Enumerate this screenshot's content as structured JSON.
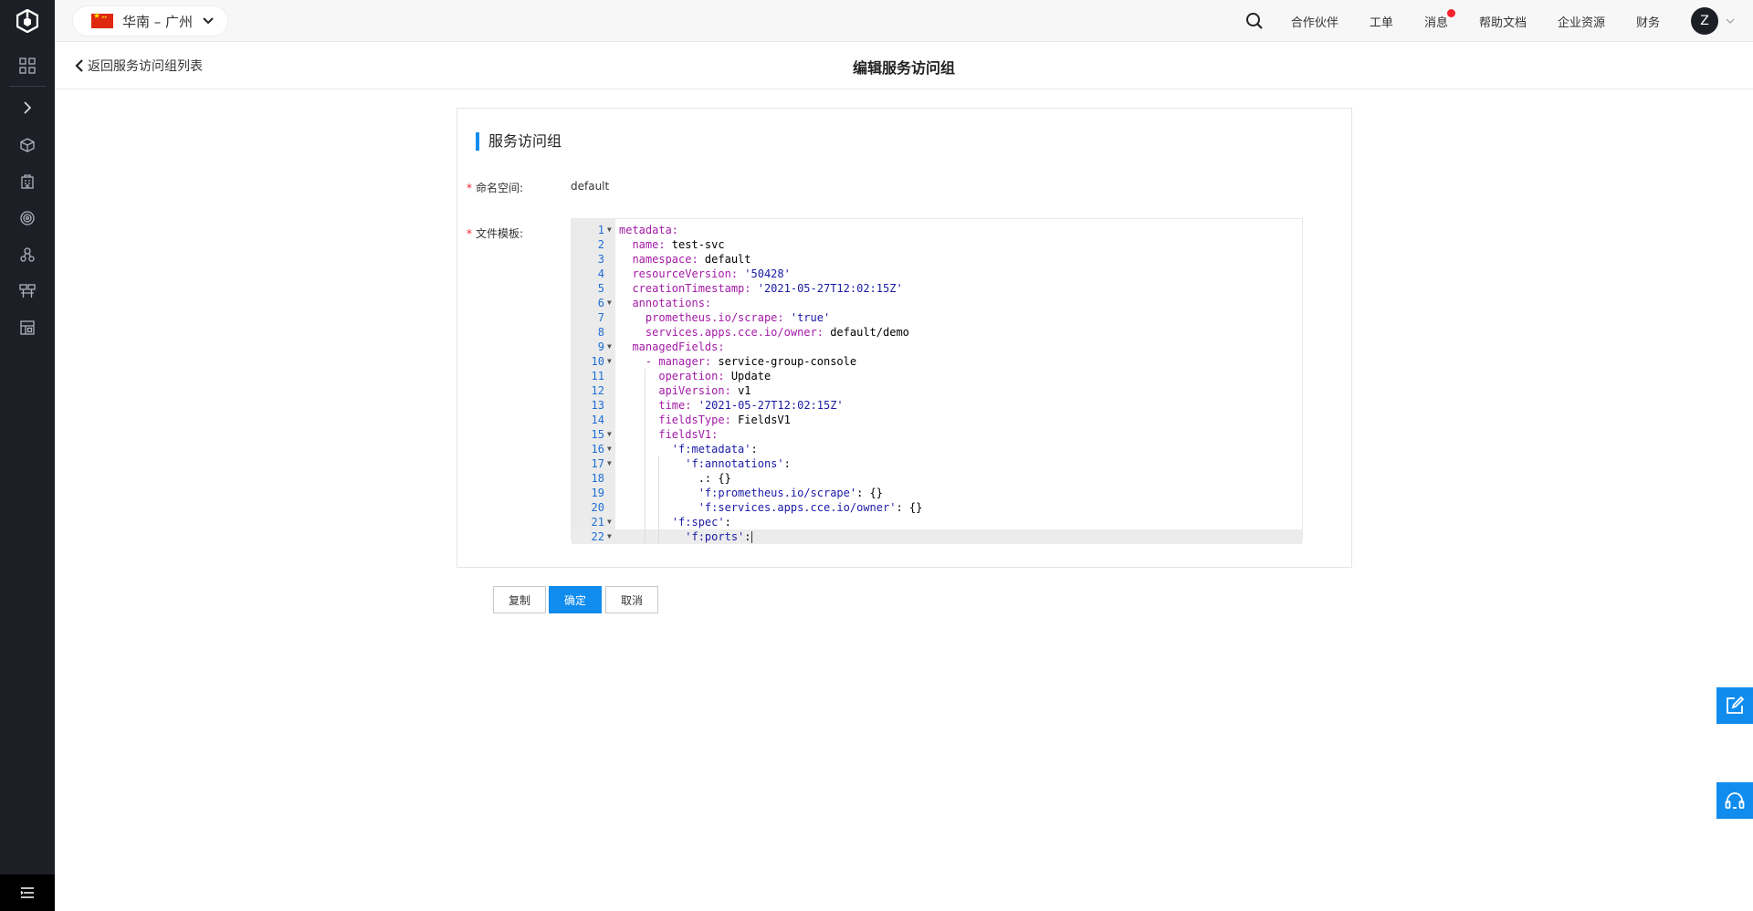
{
  "topbar": {
    "region_label": "华南 – 广州",
    "nav": [
      "合作伙伴",
      "工单",
      "消息",
      "帮助文档",
      "企业资源",
      "财务"
    ],
    "avatar_letter": "Z"
  },
  "subheader": {
    "back_label": "返回服务访问组列表",
    "title": "编辑服务访问组"
  },
  "card": {
    "title": "服务访问组",
    "namespace_label": "命名空间:",
    "namespace_value": "default",
    "template_label": "文件模板:"
  },
  "editor": {
    "lines": [
      {
        "n": "1",
        "fold": true,
        "indent": 0,
        "key": "metadata:",
        "val": ""
      },
      {
        "n": "2",
        "fold": false,
        "indent": 1,
        "key": "name:",
        "val": " test-svc"
      },
      {
        "n": "3",
        "fold": false,
        "indent": 1,
        "key": "namespace:",
        "val": " default"
      },
      {
        "n": "4",
        "fold": false,
        "indent": 1,
        "key": "resourceVersion:",
        "sval": " '50428'"
      },
      {
        "n": "5",
        "fold": false,
        "indent": 1,
        "key": "creationTimestamp:",
        "sval": " '2021-05-27T12:02:15Z'"
      },
      {
        "n": "6",
        "fold": true,
        "indent": 1,
        "key": "annotations:",
        "val": ""
      },
      {
        "n": "7",
        "fold": false,
        "indent": 2,
        "key": "prometheus.io/scrape:",
        "sval": " 'true'"
      },
      {
        "n": "8",
        "fold": false,
        "indent": 2,
        "key": "services.apps.cce.io/owner:",
        "val": " default/demo"
      },
      {
        "n": "9",
        "fold": true,
        "indent": 1,
        "key": "managedFields:",
        "val": ""
      },
      {
        "n": "10",
        "fold": true,
        "indent": 2,
        "key": "- manager:",
        "val": " service-group-console"
      },
      {
        "n": "11",
        "fold": false,
        "indent": 3,
        "key": "operation:",
        "val": " Update"
      },
      {
        "n": "12",
        "fold": false,
        "indent": 3,
        "key": "apiVersion:",
        "val": " v1"
      },
      {
        "n": "13",
        "fold": false,
        "indent": 3,
        "key": "time:",
        "sval": " '2021-05-27T12:02:15Z'"
      },
      {
        "n": "14",
        "fold": false,
        "indent": 3,
        "key": "fieldsType:",
        "val": " FieldsV1"
      },
      {
        "n": "15",
        "fold": true,
        "indent": 3,
        "key": "fieldsV1:",
        "val": ""
      },
      {
        "n": "16",
        "fold": true,
        "indent": 4,
        "skey": "'f:metadata'",
        "val": ":"
      },
      {
        "n": "17",
        "fold": true,
        "indent": 5,
        "skey": "'f:annotations'",
        "val": ":"
      },
      {
        "n": "18",
        "fold": false,
        "indent": 6,
        "key": "",
        "val": ".: {}"
      },
      {
        "n": "19",
        "fold": false,
        "indent": 6,
        "skey": "'f:prometheus.io/scrape'",
        "val": ": {}"
      },
      {
        "n": "20",
        "fold": false,
        "indent": 6,
        "skey": "'f:services.apps.cce.io/owner'",
        "val": ": {}"
      },
      {
        "n": "21",
        "fold": true,
        "indent": 4,
        "skey": "'f:spec'",
        "val": ":"
      },
      {
        "n": "22",
        "fold": true,
        "indent": 5,
        "skey": "'f:ports'",
        "val": ":",
        "active": true
      }
    ]
  },
  "buttons": {
    "copy": "复制",
    "confirm": "确定",
    "cancel": "取消"
  },
  "colors": {
    "accent": "#108cee",
    "sidebar_bg": "#1d1f26",
    "notification_dot": "#f5222d"
  },
  "icons": {
    "sidebar": [
      "grid-icon",
      "chevron-right-icon",
      "cube-icon",
      "building-icon",
      "target-icon",
      "cluster-icon",
      "network-icon",
      "image-icon"
    ],
    "floating": [
      "edit-icon",
      "headset-icon"
    ]
  }
}
